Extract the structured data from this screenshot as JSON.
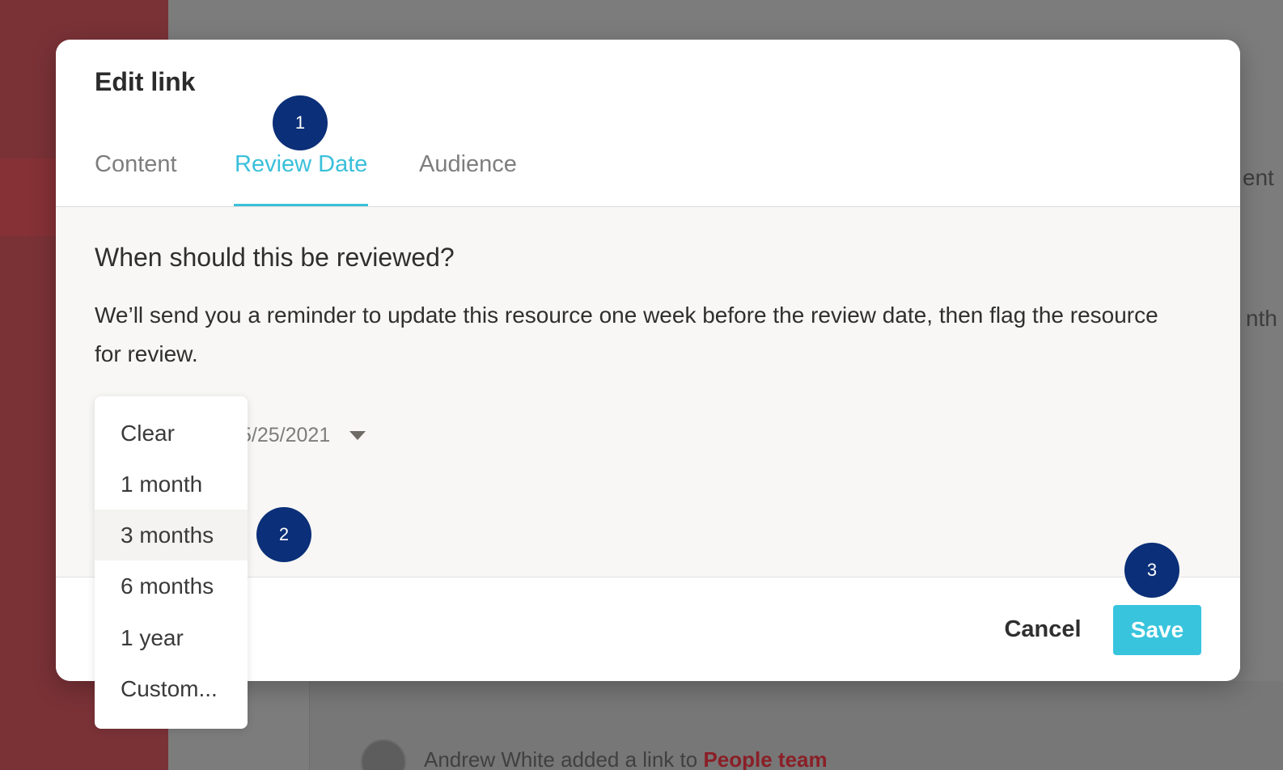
{
  "background": {
    "activity_text": "Andrew White added a link to",
    "activity_link": "People team",
    "right_fragment_1": "ent",
    "right_fragment_2": "nth"
  },
  "modal": {
    "title": "Edit link",
    "tabs": [
      {
        "label": "Content",
        "active": false
      },
      {
        "label": "Review Date",
        "active": true
      },
      {
        "label": "Audience",
        "active": false
      }
    ],
    "question": "When should this be reviewed?",
    "description": "We’ll send you a reminder to update this resource one week before the review date, then flag the resource for review.",
    "date_value": "5/25/2021",
    "cancel_label": "Cancel",
    "save_label": "Save"
  },
  "dropdown": {
    "options": [
      "Clear",
      "1 month",
      "3 months",
      "6 months",
      "1 year",
      "Custom..."
    ],
    "highlighted": "3 months"
  },
  "badges": [
    "1",
    "2",
    "3"
  ],
  "colors": {
    "accent": "#3ac0da",
    "badge": "#0b2f78",
    "sidebar": "#7a3237",
    "link": "#8a1f27"
  }
}
